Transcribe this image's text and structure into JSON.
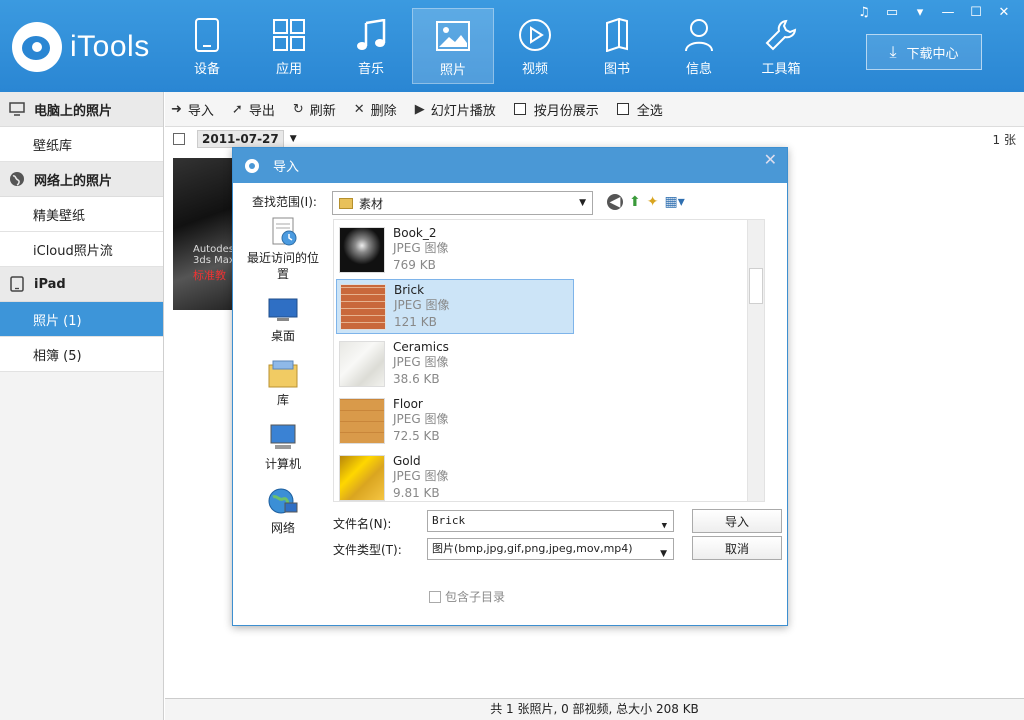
{
  "app": {
    "name": "iTools"
  },
  "nav": [
    {
      "label": "设备",
      "icon": "phone-icon"
    },
    {
      "label": "应用",
      "icon": "apps-grid-icon"
    },
    {
      "label": "音乐",
      "icon": "music-note-icon"
    },
    {
      "label": "照片",
      "icon": "photo-icon",
      "active": true
    },
    {
      "label": "视频",
      "icon": "play-icon"
    },
    {
      "label": "图书",
      "icon": "book-icon"
    },
    {
      "label": "信息",
      "icon": "user-icon"
    },
    {
      "label": "工具箱",
      "icon": "wrench-icon"
    }
  ],
  "download_center": "下载中心",
  "sidebar": {
    "groups": [
      {
        "label": "电脑上的照片",
        "icon": "monitor-icon",
        "items": [
          {
            "label": "壁纸库"
          }
        ]
      },
      {
        "label": "网络上的照片",
        "icon": "globe-icon",
        "items": [
          {
            "label": "精美壁纸"
          },
          {
            "label": "iCloud照片流"
          }
        ]
      },
      {
        "label": "iPad",
        "icon": "tablet-icon",
        "items": [
          {
            "label": "照片 (1)",
            "active": true
          },
          {
            "label": "相簿 (5)"
          }
        ]
      }
    ]
  },
  "toolbar": {
    "import": "导入",
    "export": "导出",
    "refresh": "刷新",
    "delete": "删除",
    "slideshow": "幻灯片播放",
    "by_month": "按月份展示",
    "select_all": "全选"
  },
  "content": {
    "date": "2011-07-27",
    "count": "1 张",
    "thumb_text_1": "Autodesk",
    "thumb_text_2": "3ds Max",
    "thumb_text_3": "标准教"
  },
  "status": "共 1 张照片, 0 部视频, 总大小 208 KB",
  "dialog": {
    "title": "导入",
    "look_in_label": "查找范围(I):",
    "look_in_value": "素材",
    "places": [
      {
        "label": "最近访问的位置",
        "icon": "recent-places-icon"
      },
      {
        "label": "桌面",
        "icon": "desktop-icon"
      },
      {
        "label": "库",
        "icon": "library-icon"
      },
      {
        "label": "计算机",
        "icon": "computer-icon"
      },
      {
        "label": "网络",
        "icon": "network-icon"
      }
    ],
    "files": [
      {
        "name": "Book_2",
        "type": "JPEG 图像",
        "size": "769 KB"
      },
      {
        "name": "Brick",
        "type": "JPEG 图像",
        "size": "121 KB",
        "selected": true
      },
      {
        "name": "Ceramics",
        "type": "JPEG 图像",
        "size": "38.6 KB"
      },
      {
        "name": "Floor",
        "type": "JPEG 图像",
        "size": "72.5 KB"
      },
      {
        "name": "Gold",
        "type": "JPEG 图像",
        "size": "9.81 KB"
      }
    ],
    "filename_label": "文件名(N):",
    "filename_value": "Brick",
    "filetype_label": "文件类型(T):",
    "filetype_value": "图片(bmp,jpg,gif,png,jpeg,mov,mp4)",
    "import_button": "导入",
    "cancel_button": "取消",
    "subdir_label": "包含子目录"
  }
}
